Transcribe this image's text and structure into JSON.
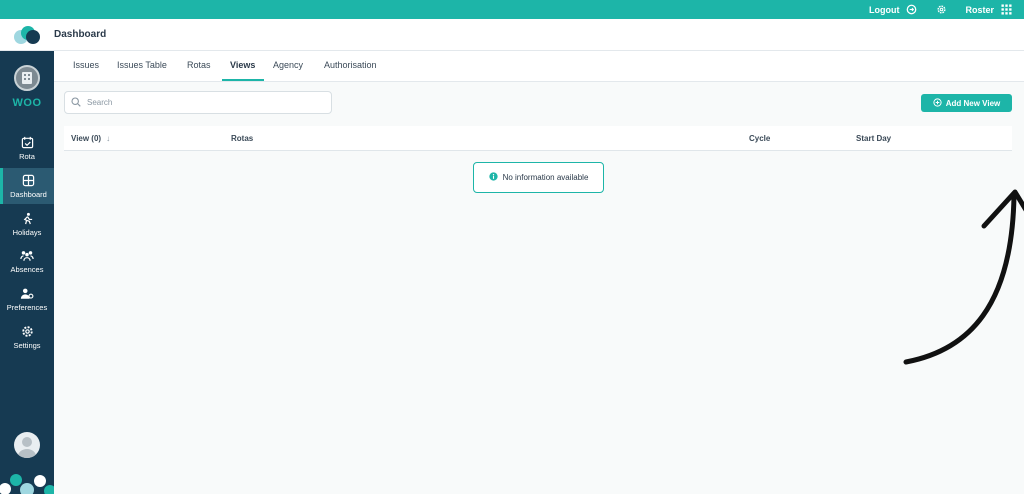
{
  "topbar": {
    "logout_label": "Logout",
    "roster_label": "Roster",
    "icons": [
      "logout-icon",
      "gear-icon",
      "grid-icon"
    ]
  },
  "header": {
    "title": "Dashboard"
  },
  "sidebar": {
    "org_name": "WOO",
    "items": [
      {
        "label": "Rota",
        "icon": "calendar-check-icon"
      },
      {
        "label": "Dashboard",
        "icon": "dashboard-icon",
        "active": true
      },
      {
        "label": "Holidays",
        "icon": "holidays-icon"
      },
      {
        "label": "Absences",
        "icon": "absences-icon"
      },
      {
        "label": "Preferences",
        "icon": "preferences-icon"
      },
      {
        "label": "Settings",
        "icon": "gear-icon"
      }
    ]
  },
  "tabs": [
    {
      "label": "Issues"
    },
    {
      "label": "Issues Table"
    },
    {
      "label": "Rotas"
    },
    {
      "label": "Views",
      "active": true
    },
    {
      "label": "Agency"
    },
    {
      "label": "Authorisation"
    }
  ],
  "search": {
    "placeholder": "Search",
    "value": ""
  },
  "add_button": {
    "label": "Add New View"
  },
  "table": {
    "columns": [
      "View (0)",
      "Rotas",
      "Cycle",
      "Start Day"
    ],
    "sort_indicator": "↓",
    "rows": []
  },
  "empty_state": {
    "message": "No information available"
  },
  "colors": {
    "accent": "#1db5a8",
    "sidebar_bg": "#163a52",
    "annotation": "#111111"
  }
}
